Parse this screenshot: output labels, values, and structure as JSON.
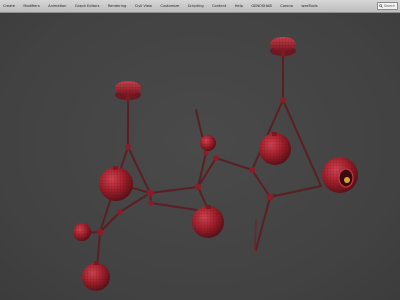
{
  "menubar": {
    "items": [
      {
        "label": "Create"
      },
      {
        "label": "Modifiers"
      },
      {
        "label": "Animation"
      },
      {
        "label": "Graph Editors"
      },
      {
        "label": "Rendering"
      },
      {
        "label": "Civil View"
      },
      {
        "label": "Customize"
      },
      {
        "label": "Scripting"
      },
      {
        "label": "Content"
      },
      {
        "label": "Help"
      },
      {
        "label": "GENOSHAB"
      },
      {
        "label": "Corona"
      },
      {
        "label": "weeTools"
      }
    ],
    "search": {
      "label": "Search"
    }
  },
  "viewport": {
    "model_color": "#a0202c",
    "highlight_color": "#c93a45",
    "rod_color": "#5a1f24",
    "background": "#464646"
  }
}
